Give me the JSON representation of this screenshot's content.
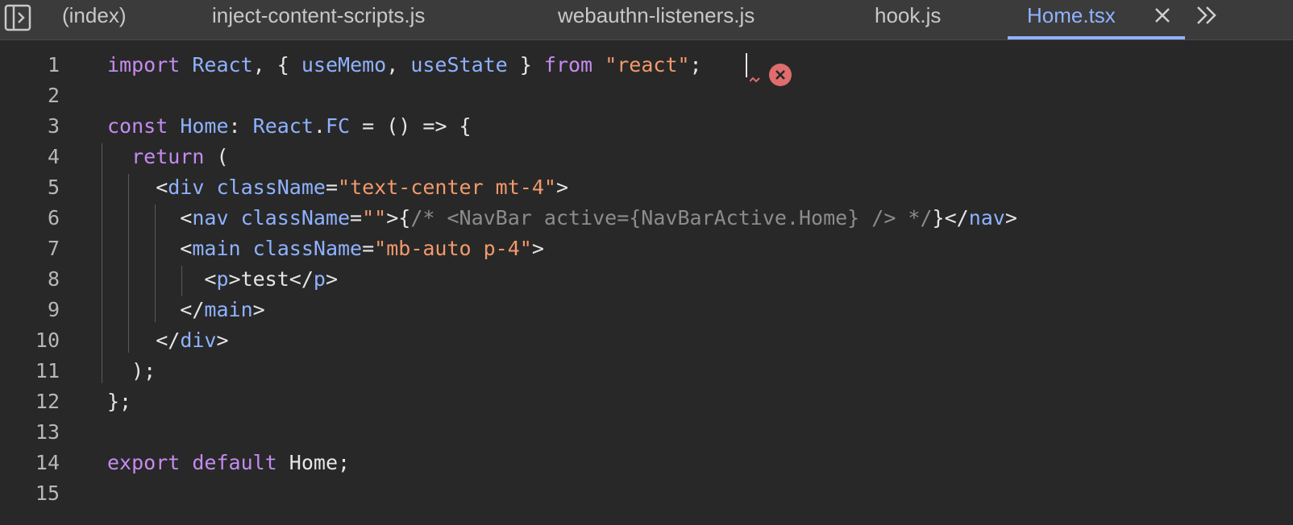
{
  "tabs": [
    {
      "label": "(index)",
      "active": false
    },
    {
      "label": "inject-content-scripts.js",
      "active": false
    },
    {
      "label": "webauthn-listeners.js",
      "active": false
    },
    {
      "label": "hook.js",
      "active": false
    },
    {
      "label": "Home.tsx",
      "active": true
    }
  ],
  "icons": {
    "sidebar_toggle": "sidebar-toggle-icon",
    "close": "close-icon",
    "overflow": "chevron-double-right-icon",
    "error": "error-icon"
  },
  "colors": {
    "keyword": "#c58bf0",
    "identifier": "#8fb2ff",
    "string": "#f29a6b",
    "comment": "#8c8c8c",
    "error": "#e06c6c",
    "active_tab": "#8fb2ff"
  },
  "editor": {
    "line_numbers": [
      "1",
      "2",
      "3",
      "4",
      "5",
      "6",
      "7",
      "8",
      "9",
      "10",
      "11",
      "12",
      "13",
      "14",
      "15"
    ],
    "tokens": {
      "l1": [
        "import",
        " ",
        "React",
        ", { ",
        "useMemo",
        ", ",
        "useState",
        " } ",
        "from",
        " ",
        "\"react\"",
        ";"
      ],
      "l3": [
        "const",
        " ",
        "Home",
        ": ",
        "React",
        ".",
        "FC",
        " = () => {"
      ],
      "l4": [
        "  ",
        "return",
        " ("
      ],
      "l5": [
        "    <",
        "div",
        " ",
        "className",
        "=",
        "\"text-center mt-4\"",
        ">"
      ],
      "l6": [
        "      <",
        "nav",
        " ",
        "className",
        "=",
        "\"\"",
        ">{",
        "/* <NavBar active={NavBarActive.Home} /> */",
        "}</",
        "nav",
        ">"
      ],
      "l7": [
        "      <",
        "main",
        " ",
        "className",
        "=",
        "\"mb-auto p-4\"",
        ">"
      ],
      "l8": [
        "        <",
        "p",
        ">test</",
        "p",
        ">"
      ],
      "l9": [
        "      </",
        "main",
        ">"
      ],
      "l10": [
        "    </",
        "div",
        ">"
      ],
      "l11": [
        "  );"
      ],
      "l12": [
        "};"
      ],
      "l14": [
        "export",
        " ",
        "default",
        " ",
        "Home;"
      ]
    }
  }
}
